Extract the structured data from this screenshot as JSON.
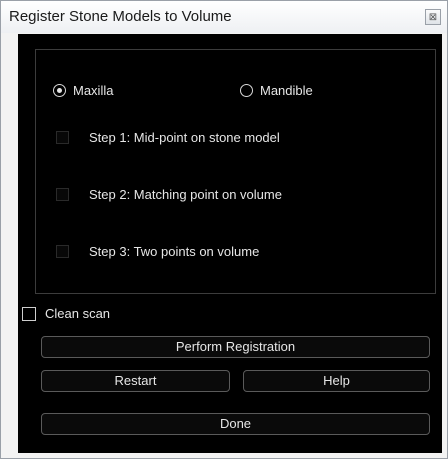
{
  "window": {
    "title": "Register Stone Models to Volume",
    "close_glyph": "⊠"
  },
  "jaw_selection": {
    "options": [
      {
        "label": "Maxilla",
        "selected": true
      },
      {
        "label": "Mandible",
        "selected": false
      }
    ]
  },
  "steps": [
    {
      "label": "Step 1: Mid-point on stone model",
      "checked": false,
      "enabled": false
    },
    {
      "label": "Step 2: Matching point on volume",
      "checked": false,
      "enabled": false
    },
    {
      "label": "Step 3: Two points on volume",
      "checked": false,
      "enabled": false
    }
  ],
  "clean_scan": {
    "label": "Clean scan",
    "checked": false
  },
  "buttons": {
    "perform_registration": "Perform Registration",
    "restart": "Restart",
    "help": "Help",
    "done": "Done"
  },
  "icons": {
    "close": "close-icon"
  },
  "colors": {
    "panel_background": "#000000",
    "text": "#e6e6e6",
    "button_border": "#5a5a5a"
  }
}
